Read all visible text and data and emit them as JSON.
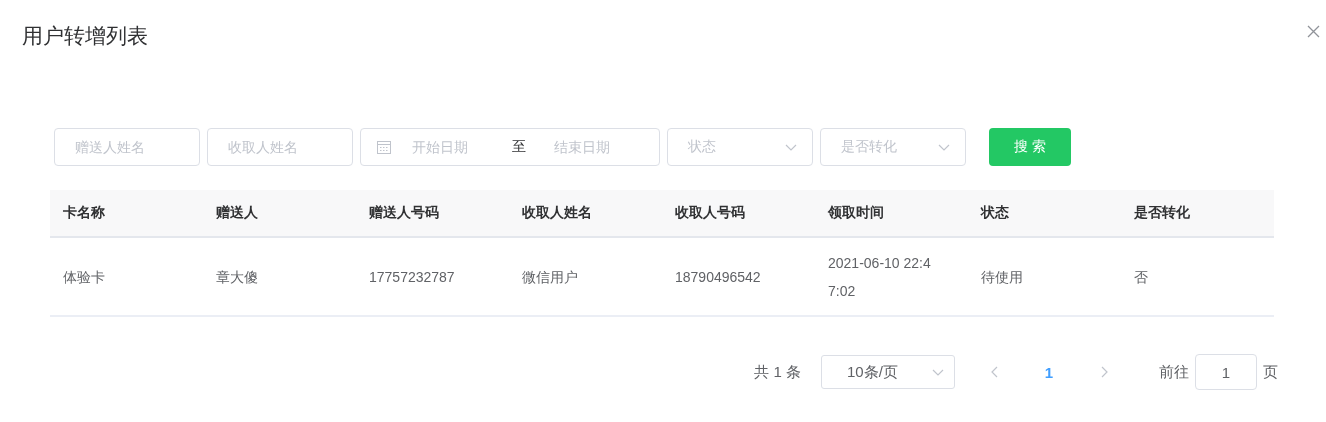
{
  "dialog": {
    "title": "用户转增列表"
  },
  "filters": [
    {
      "kind": "text",
      "placeholder": "赠送人姓名"
    },
    {
      "kind": "text",
      "placeholder": "收取人姓名"
    },
    {
      "kind": "daterange",
      "start_placeholder": "开始日期",
      "separator": "至",
      "end_placeholder": "结束日期"
    },
    {
      "kind": "select",
      "placeholder": "状态"
    },
    {
      "kind": "select",
      "placeholder": "是否转化"
    }
  ],
  "search_button": "搜 索",
  "table": {
    "columns": [
      "卡名称",
      "赠送人",
      "赠送人号码",
      "收取人姓名",
      "收取人号码",
      "领取时间",
      "状态",
      "是否转化"
    ],
    "rows": [
      [
        "体验卡",
        "章大傻",
        "17757232787",
        "微信用户",
        "18790496542",
        "2021-06-10 22:47:02",
        "待使用",
        "否"
      ]
    ]
  },
  "pagination": {
    "total": "共 1 条",
    "page_size": "10条/页",
    "prev_disabled": true,
    "pages": [
      {
        "label": "1",
        "selected": true
      }
    ],
    "next_disabled": true,
    "goto_label": "前往",
    "goto_value": "1",
    "goto_suffix": "页"
  }
}
